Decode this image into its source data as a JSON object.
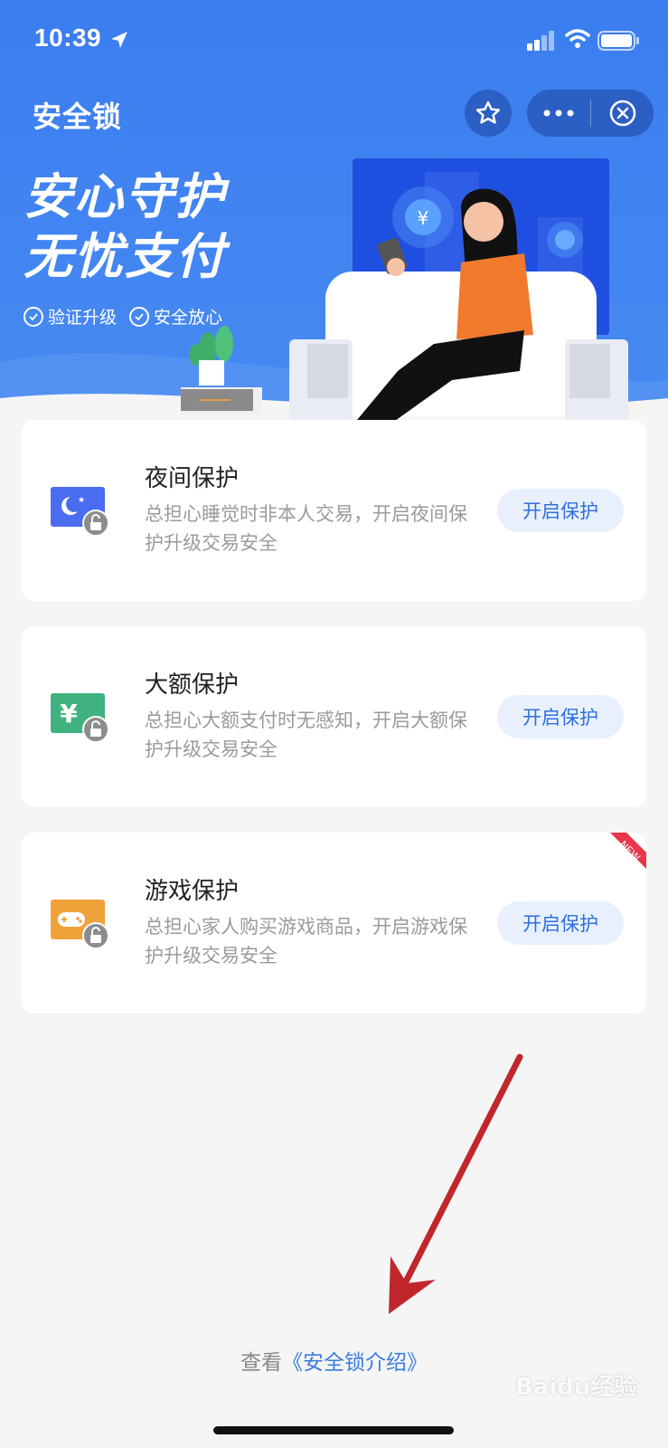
{
  "status_bar": {
    "time": "10:39"
  },
  "nav": {
    "title": "安全锁"
  },
  "hero": {
    "title_line1": "安心守护",
    "title_line2": "无忧支付",
    "tags": [
      "验证升级",
      "安全放心"
    ]
  },
  "cards": [
    {
      "title": "夜间保护",
      "desc": "总担心睡觉时非本人交易，开启夜间保护升级交易安全",
      "button": "开启保护",
      "icon": "moon-lock-icon",
      "icon_color": "#4a6cf0"
    },
    {
      "title": "大额保护",
      "desc": "总担心大额支付时无感知，开启大额保护升级交易安全",
      "button": "开启保护",
      "icon": "yuan-lock-icon",
      "icon_color": "#3fb27f"
    },
    {
      "title": "游戏保护",
      "desc": "总担心家人购买游戏商品，开启游戏保护升级交易安全",
      "button": "开启保护",
      "icon": "gamepad-lock-icon",
      "icon_color": "#f0a23a",
      "badge": "NEW"
    }
  ],
  "footer": {
    "prefix": "查看",
    "link": "《安全锁介绍》"
  },
  "watermark": "Baidu经验",
  "colors": {
    "primary": "#3a7df0",
    "button_bg": "#e8f0fd",
    "button_text": "#2f6fe0",
    "badge": "#e8364a",
    "annotation_arrow": "#c0272d"
  }
}
